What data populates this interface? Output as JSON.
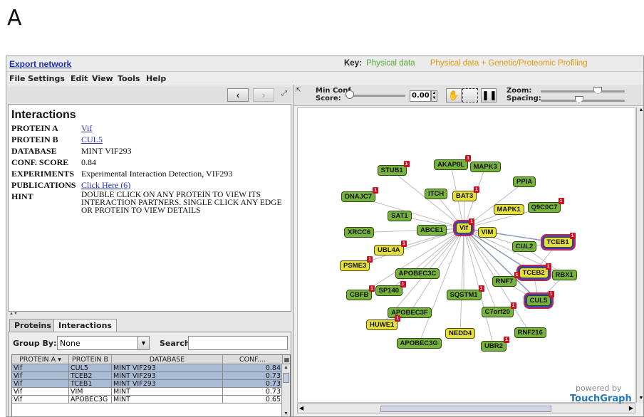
{
  "figure_label": "A",
  "header": {
    "export_link": "Export network",
    "key_label": "Key:",
    "key_physical": "Physical data",
    "key_profiling": "Physical data + Genetic/Proteomic Profiling"
  },
  "menu": {
    "file": "File",
    "settings": "Settings",
    "edit": "Edit",
    "view": "View",
    "tools": "Tools",
    "help": "Help"
  },
  "nav": {
    "back": "‹",
    "forward": "›"
  },
  "details": {
    "title": "Interactions",
    "rows": [
      {
        "label": "PROTEIN A",
        "value": "Vif"
      },
      {
        "label": "PROTEIN B",
        "value": "CUL5"
      },
      {
        "label": "DATABASE",
        "value": "MINT VIF293"
      },
      {
        "label": "CONF. SCORE",
        "value": "0.84"
      },
      {
        "label": "EXPERIMENTS",
        "value": "Experimental Interaction Detection, VIF293"
      },
      {
        "label": "PUBLICATIONS",
        "value": "Click Here (6)"
      },
      {
        "label": "HINT",
        "value": "DOUBLE CLICK ON ANY PROTEIN TO VIEW ITS INTERACTION PARTNERS. SINGLE CLICK ANY EDGE OR PROTEIN TO VIEW DETAILS"
      }
    ]
  },
  "tabs": {
    "proteins": "Proteins",
    "interactions": "Interactions"
  },
  "filter": {
    "group_by_label": "Group By:",
    "group_by_value": "None",
    "search_label": "Search",
    "search_value": ""
  },
  "table": {
    "headers": [
      "PROTEIN A ▾",
      "PROTEIN B",
      "DATABASE",
      "CONF...."
    ],
    "rows": [
      {
        "a": "Vif",
        "b": "CUL5",
        "db": "MINT VIF293",
        "conf": "0.84",
        "selected": true
      },
      {
        "a": "Vif",
        "b": "TCEB2",
        "db": "MINT VIF293",
        "conf": "0.73",
        "selected": true
      },
      {
        "a": "Vif",
        "b": "TCEB1",
        "db": "MINT VIF293",
        "conf": "0.73",
        "selected": true
      },
      {
        "a": "Vif",
        "b": "VIM",
        "db": "MINT",
        "conf": "0.73",
        "selected": false
      },
      {
        "a": "Vif",
        "b": "APOBEC3G",
        "db": "MINT",
        "conf": "0.65",
        "selected": false
      }
    ]
  },
  "graph_toolbar": {
    "min_conf_label1": "Min Conf",
    "min_conf_label2": "Score:",
    "min_conf_value": "0.00",
    "min_conf_level": 0.0,
    "zoom_label": "Zoom:",
    "spacing_label": "Spacing:",
    "zoom_level": 0.7,
    "spacing_level": 0.45
  },
  "graph": {
    "center": "Vif",
    "nodes": [
      {
        "label": "STUB1",
        "color": "g",
        "badge": "1"
      },
      {
        "label": "AKAP8L",
        "color": "g",
        "badge": "1"
      },
      {
        "label": "MAPK3",
        "color": "g",
        "badge": ""
      },
      {
        "label": "PPIA",
        "color": "g",
        "badge": ""
      },
      {
        "label": "DNAJC7",
        "color": "g",
        "badge": "1"
      },
      {
        "label": "ITCH",
        "color": "g",
        "badge": ""
      },
      {
        "label": "BAT3",
        "color": "y",
        "badge": "1"
      },
      {
        "label": "MAPK1",
        "color": "y",
        "badge": ""
      },
      {
        "label": "Q9C0C7",
        "color": "g",
        "badge": "1"
      },
      {
        "label": "SAT1",
        "color": "g",
        "badge": ""
      },
      {
        "label": "XRCC6",
        "color": "g",
        "badge": ""
      },
      {
        "label": "ABCE1",
        "color": "g",
        "badge": ""
      },
      {
        "label": "VIM",
        "color": "y",
        "badge": ""
      },
      {
        "label": "TCEB1",
        "color": "y",
        "badge": "1"
      },
      {
        "label": "UBL4A",
        "color": "y",
        "badge": "1"
      },
      {
        "label": "CUL2",
        "color": "g",
        "badge": ""
      },
      {
        "label": "PSME3",
        "color": "y",
        "badge": "1"
      },
      {
        "label": "APOBEC3C",
        "color": "g",
        "badge": ""
      },
      {
        "label": "TCEB2",
        "color": "y",
        "badge": "1"
      },
      {
        "label": "RBX1",
        "color": "g",
        "badge": ""
      },
      {
        "label": "RNF7",
        "color": "g",
        "badge": "1"
      },
      {
        "label": "CBFB",
        "color": "g",
        "badge": "1"
      },
      {
        "label": "SP140",
        "color": "g",
        "badge": "1"
      },
      {
        "label": "SQSTM1",
        "color": "g",
        "badge": "1"
      },
      {
        "label": "CUL5",
        "color": "g",
        "badge": "1"
      },
      {
        "label": "APOBEC3F",
        "color": "g",
        "badge": ""
      },
      {
        "label": "C7orf20",
        "color": "g",
        "badge": "1"
      },
      {
        "label": "HUWE1",
        "color": "y",
        "badge": "1"
      },
      {
        "label": "NEDD4",
        "color": "y",
        "badge": ""
      },
      {
        "label": "RNF216",
        "color": "g",
        "badge": ""
      },
      {
        "label": "APOBEC3G",
        "color": "g",
        "badge": ""
      },
      {
        "label": "UBR2",
        "color": "g",
        "badge": "1"
      }
    ]
  },
  "branding": {
    "powered_by": "powered by",
    "touchgraph": "TouchGraph"
  }
}
